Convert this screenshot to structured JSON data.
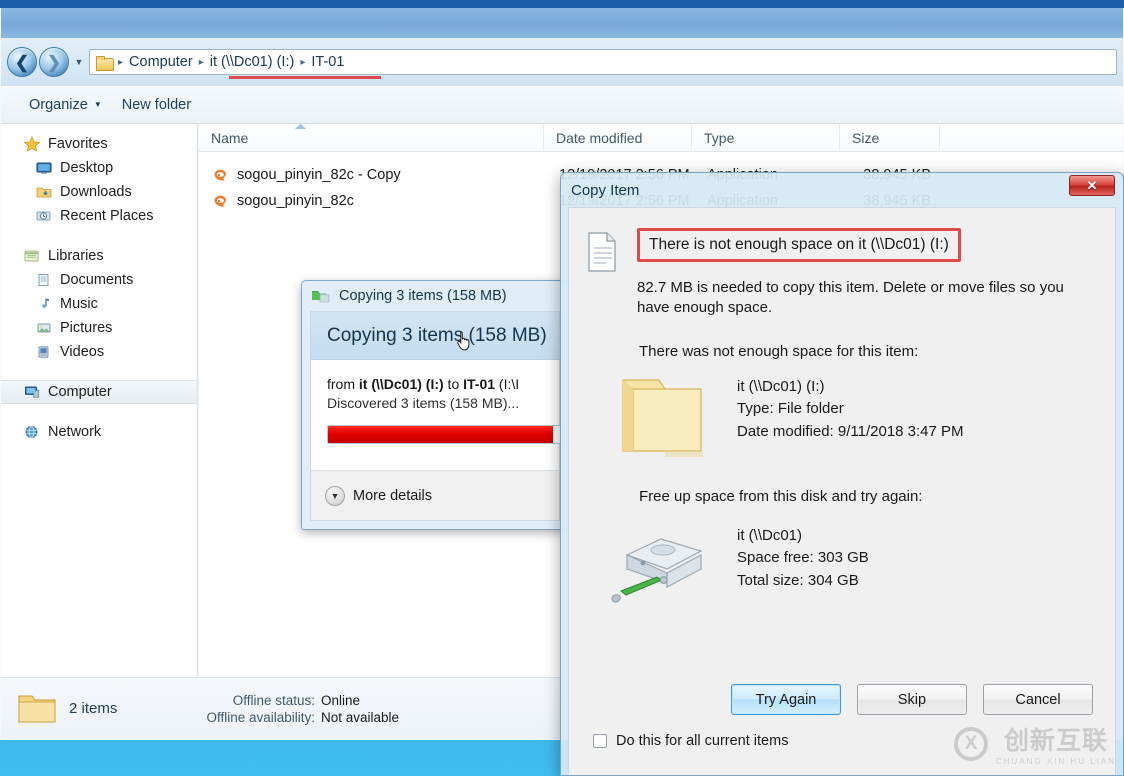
{
  "window": {
    "title": "",
    "nav": {
      "back_icon": "back-arrow-icon",
      "forward_icon": "forward-arrow-icon",
      "history_icon": "chevron-down-icon"
    },
    "breadcrumb": {
      "folder_icon": "folder-icon",
      "items": [
        "Computer",
        "it (\\\\Dc01) (I:)",
        "IT-01"
      ],
      "separator": "▸",
      "highlight_color": "#e04a4a"
    },
    "toolbar": {
      "organize_label": "Organize",
      "organize_caret": "▾",
      "new_folder_label": "New folder"
    }
  },
  "sidebar": {
    "groups": [
      {
        "header": {
          "label": "Favorites",
          "icon": "star-icon"
        },
        "items": [
          {
            "label": "Desktop",
            "icon": "desktop-icon"
          },
          {
            "label": "Downloads",
            "icon": "downloads-folder-icon"
          },
          {
            "label": "Recent Places",
            "icon": "recent-places-icon"
          }
        ]
      },
      {
        "header": {
          "label": "Libraries",
          "icon": "libraries-icon"
        },
        "items": [
          {
            "label": "Documents",
            "icon": "documents-library-icon"
          },
          {
            "label": "Music",
            "icon": "music-library-icon"
          },
          {
            "label": "Pictures",
            "icon": "pictures-library-icon"
          },
          {
            "label": "Videos",
            "icon": "videos-library-icon"
          }
        ]
      },
      {
        "header": {
          "label": "Computer",
          "icon": "computer-icon",
          "selected": true
        },
        "items": []
      },
      {
        "header": {
          "label": "Network",
          "icon": "network-icon"
        },
        "items": []
      }
    ]
  },
  "filelist": {
    "columns": [
      "Name",
      "Date modified",
      "Type",
      "Size"
    ],
    "sorted_column": "Name",
    "rows": [
      {
        "icon": "sogou-app-icon",
        "name": "sogou_pinyin_82c - Copy",
        "date_modified": "12/19/2017 2:56 PM",
        "type": "Application",
        "size": "38,945 KB"
      },
      {
        "icon": "sogou-app-icon",
        "name": "sogou_pinyin_82c",
        "date_modified": "12/19/2017 2:56 PM",
        "type": "Application",
        "size": "38,945 KB"
      }
    ]
  },
  "statusbar": {
    "folder_icon": "folder-icon",
    "item_count": "2 items",
    "offline_status_label": "Offline status:",
    "offline_status_value": "Online",
    "offline_availability_label": "Offline availability:",
    "offline_availability_value": "Not available"
  },
  "progress_dialog": {
    "taskbar_icon": "copy-animation-icon",
    "title": "Copying 3 items (158 MB)",
    "heading": "Copying 3 items (158 MB)",
    "from_prefix": "from ",
    "source": "it (\\\\Dc01) (I:)",
    "to_word": " to ",
    "destination": "IT-01",
    "destination_path": " (I:\\I",
    "discovered": "Discovered 3 items (158 MB)...",
    "progress_percent": 96,
    "progress_color": "#e00000",
    "more_details_label": "More details",
    "more_details_icon": "chevron-down-icon"
  },
  "copy_item_dialog": {
    "title": "Copy Item",
    "close_label": "✕",
    "document_icon": "document-icon",
    "error_heading": "There is not enough space on it (\\\\Dc01) (I:)",
    "error_highlight_color": "#e04a4a",
    "error_detail": "82.7 MB is needed to copy this item. Delete or move files so you have enough space.",
    "item_section_label": "There was not enough space for this item:",
    "item": {
      "icon": "folder-icon",
      "name": "it (\\\\Dc01) (I:)",
      "type_line": "Type: File folder",
      "date_line": "Date modified: 9/11/2018 3:47 PM"
    },
    "disk_section_label": "Free up space from this disk and try again:",
    "disk": {
      "icon": "hard-disk-icon",
      "name": "it (\\\\Dc01)",
      "space_free": "Space free: 303 GB",
      "total_size": "Total size: 304 GB"
    },
    "buttons": [
      {
        "label": "Try Again",
        "primary": true
      },
      {
        "label": "Skip",
        "primary": false
      },
      {
        "label": "Cancel",
        "primary": false
      }
    ],
    "checkbox": {
      "label": "Do this for all current items",
      "checked": false
    }
  },
  "watermark": {
    "mark": "X",
    "chinese": "创新互联",
    "pinyin": "CHUANG XIN HU LIAN"
  }
}
